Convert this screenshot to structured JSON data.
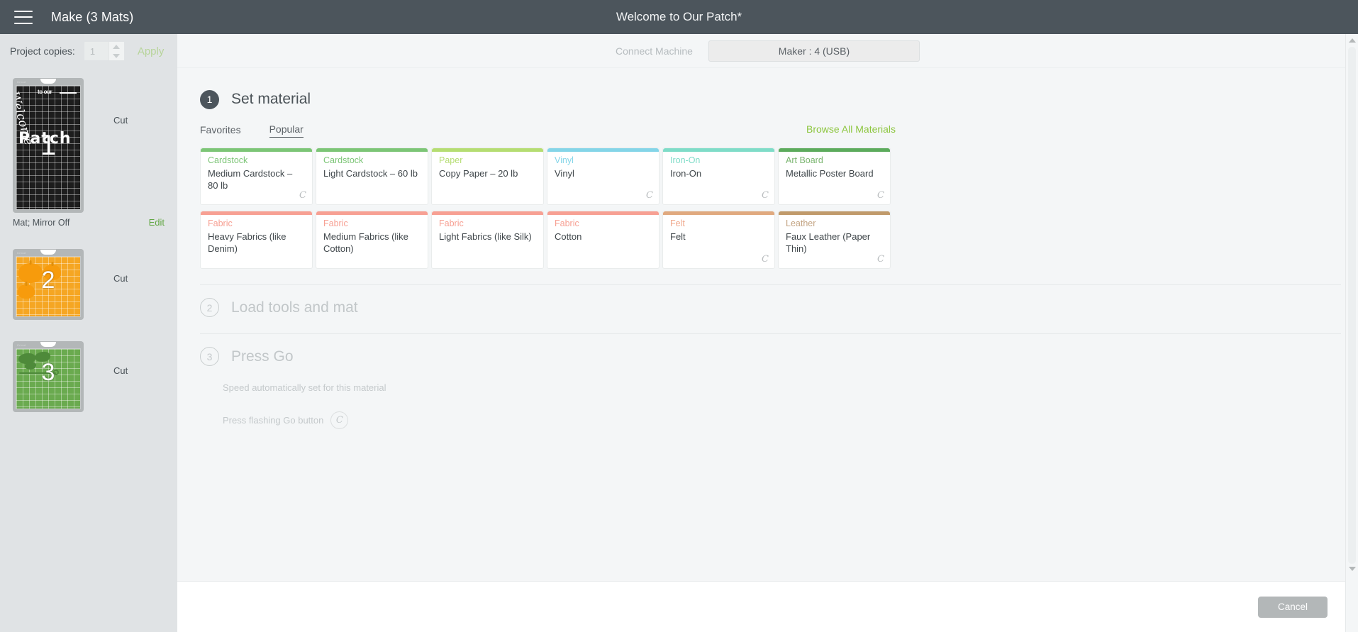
{
  "topbar": {
    "menu_icon": "hamburger-icon",
    "left_title": "Make (3 Mats)",
    "center_title": "Welcome to Our Patch*"
  },
  "subbar": {
    "copies_label": "Project copies:",
    "copies_value": "1",
    "copies_placeholder": "1",
    "apply_label": "Apply",
    "connect_label": "Connect Machine",
    "machine_label": "Maker : 4 (USB)"
  },
  "sidebar": {
    "mats": [
      {
        "number": "1",
        "status": "Cut",
        "caption": "Mat; Mirror Off",
        "edit_label": "Edit",
        "art_welcome": "Welcome",
        "art_toour": "to our",
        "art_patch": "Patch"
      },
      {
        "number": "2",
        "status": "Cut"
      },
      {
        "number": "3",
        "status": "Cut"
      }
    ]
  },
  "main": {
    "step1": {
      "badge": "1",
      "title": "Set material",
      "tabs": [
        {
          "label": "Favorites",
          "active": false
        },
        {
          "label": "Popular",
          "active": true
        }
      ],
      "browse_link": "Browse All Materials",
      "cards_row1": [
        {
          "category": "Cardstock",
          "name": "Medium Cardstock – 80 lb",
          "color": "#7cc576",
          "logo": true
        },
        {
          "category": "Cardstock",
          "name": "Light Cardstock – 60 lb",
          "color": "#7cc576",
          "logo": false
        },
        {
          "category": "Paper",
          "name": "Copy Paper – 20 lb",
          "color": "#b5dd72",
          "logo": false
        },
        {
          "category": "Vinyl",
          "name": "Vinyl",
          "color": "#84d5e8",
          "logo": true
        },
        {
          "category": "Iron-On",
          "name": "Iron-On",
          "color": "#7fdcc8",
          "logo": true
        },
        {
          "category": "Art Board",
          "name": "Metallic Poster Board",
          "color": "#5cab5c",
          "logo": true
        }
      ],
      "cards_row2": [
        {
          "category": "Fabric",
          "name": "Heavy Fabrics (like Denim)",
          "color": "#f7a093",
          "logo": false
        },
        {
          "category": "Fabric",
          "name": "Medium Fabrics (like Cotton)",
          "color": "#f7a093",
          "logo": false
        },
        {
          "category": "Fabric",
          "name": "Light Fabrics (like Silk)",
          "color": "#f7a093",
          "logo": false
        },
        {
          "category": "Fabric",
          "name": "Cotton",
          "color": "#f7a093",
          "logo": false
        },
        {
          "category": "Felt",
          "name": "Felt",
          "color": "#e0a97f",
          "logo": true
        },
        {
          "category": "Leather",
          "name": "Faux Leather (Paper Thin)",
          "color": "#c09a6b",
          "logo": true
        }
      ]
    },
    "step2": {
      "badge": "2",
      "title": "Load tools and mat"
    },
    "step3": {
      "badge": "3",
      "title": "Press Go",
      "speed_note": "Speed automatically set for this material",
      "go_text": "Press flashing Go button",
      "go_icon": "cricut-c-icon"
    }
  },
  "bottombar": {
    "cancel_label": "Cancel"
  },
  "colors": {
    "topbar_bg": "#4c555c",
    "accent_green": "#8dc63f",
    "sidebar_bg": "#e0e3e5",
    "content_bg": "#f4f6f7",
    "cancel_bg": "#b3b7b8"
  }
}
